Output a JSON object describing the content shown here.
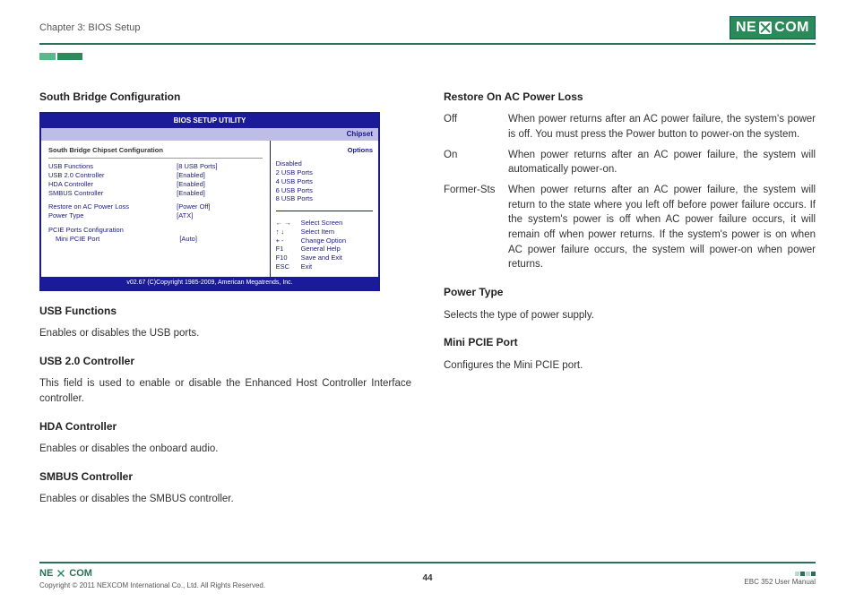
{
  "header": {
    "chapter": "Chapter 3: BIOS Setup",
    "logo_left": "NE",
    "logo_right": "COM"
  },
  "left": {
    "h_sb": "South Bridge Configuration",
    "h_usb": "USB Functions",
    "p_usb": "Enables or disables the USB ports.",
    "h_usb2": "USB 2.0 Controller",
    "p_usb2": "This field is used to enable or disable the Enhanced Host Controller Interface controller.",
    "h_hda": "HDA Controller",
    "p_hda": "Enables or disables the onboard audio.",
    "h_smbus": "SMBUS Controller",
    "p_smbus": "Enables or disables the SMBUS controller."
  },
  "right": {
    "h_restore": "Restore On AC Power Loss",
    "restore": {
      "off_k": "Off",
      "off_v": "When power returns after an AC power failure, the system's power is off. You must press the Power button to power-on the system.",
      "on_k": "On",
      "on_v": "When power returns after an AC power failure, the system will automatically power-on.",
      "fs_k": "Former-Sts",
      "fs_v": "When power returns after an AC power failure, the system will return to the state where you left off before power failure occurs. If the system's power is off when AC power failure occurs, it will remain off when power returns. If the system's power is on when AC power failure occurs, the system will power-on when power returns."
    },
    "h_pt": "Power Type",
    "p_pt": "Selects the type of power supply.",
    "h_mp": "Mini PCIE Port",
    "p_mp": "Configures the Mini PCIE port."
  },
  "bios": {
    "title": "BIOS SETUP UTILITY",
    "tab": "Chipset",
    "section": "South Bridge Chipset Configuration",
    "rows": {
      "r0k": "USB Functions",
      "r0v": "[8 USB Ports]",
      "r1k": "USB 2.0 Controller",
      "r1v": "[Enabled]",
      "r2k": "HDA Controller",
      "r2v": "[Enabled]",
      "r3k": "SMBUS Controller",
      "r3v": "[Enabled]",
      "r4k": "Restore on AC Power Loss",
      "r4v": "[Power Off]",
      "r5k": "Power Type",
      "r5v": "[ATX]",
      "r6k": "PCIE Ports Configuration",
      "r6v": "",
      "r7k": "  Mini PCIE Port",
      "r7v": "[Auto]"
    },
    "opt_label": "Options",
    "opts": {
      "o0": "Disabled",
      "o1": "2 USB Ports",
      "o2": "4 USB Ports",
      "o3": "6 USB Ports",
      "o4": "8 USB Ports"
    },
    "nav": {
      "n0k": "← →",
      "n0v": "Select Screen",
      "n1k": "↑ ↓",
      "n1v": "Select Item",
      "n2k": "+ -",
      "n2v": "Change Option",
      "n3k": "F1",
      "n3v": "General Help",
      "n4k": "F10",
      "n4v": "Save and Exit",
      "n5k": "ESC",
      "n5v": "Exit"
    },
    "foot": "v02.67 (C)Copyright 1985-2009, American Megatrends, Inc."
  },
  "footer": {
    "copy": "Copyright © 2011 NEXCOM International Co., Ltd. All Rights Reserved.",
    "page": "44",
    "manual": "EBC 352 User Manual",
    "logo": "NE COM"
  }
}
